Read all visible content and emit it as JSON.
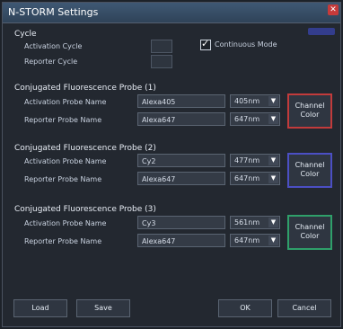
{
  "window": {
    "title": "N-STORM Settings"
  },
  "cycle": {
    "section_label": "Cycle",
    "activation_label": "Activation Cycle",
    "reporter_label": "Reporter Cycle",
    "activation_value": "",
    "reporter_value": "",
    "continuous_label": "Continuous Mode"
  },
  "probes": [
    {
      "title": "Conjugated Fluorescence Probe (1)",
      "activation_label": "Activation Probe Name",
      "activation_value": "Alexa405",
      "activation_nm": "405nm",
      "reporter_label": "Reporter Probe Name",
      "reporter_value": "Alexa647",
      "reporter_nm": "647nm",
      "color_label_1": "Channel",
      "color_label_2": "Color",
      "color": "#c23b3b"
    },
    {
      "title": "Conjugated Fluorescence Probe (2)",
      "activation_label": "Activation Probe Name",
      "activation_value": "Cy2",
      "activation_nm": "477nm",
      "reporter_label": "Reporter Probe Name",
      "reporter_value": "Alexa647",
      "reporter_nm": "647nm",
      "color_label_1": "Channel",
      "color_label_2": "Color",
      "color": "#4b4fc4"
    },
    {
      "title": "Conjugated Fluorescence Probe (3)",
      "activation_label": "Activation Probe Name",
      "activation_value": "Cy3",
      "activation_nm": "561nm",
      "reporter_label": "Reporter Probe Name",
      "reporter_value": "Alexa647",
      "reporter_nm": "647nm",
      "color_label_1": "Channel",
      "color_label_2": "Color",
      "color": "#2fa06a"
    }
  ],
  "buttons": {
    "load": "Load",
    "save": "Save",
    "ok": "OK",
    "cancel": "Cancel"
  },
  "icons": {
    "close": "close-icon",
    "dropdown": "chevron-down-icon"
  }
}
